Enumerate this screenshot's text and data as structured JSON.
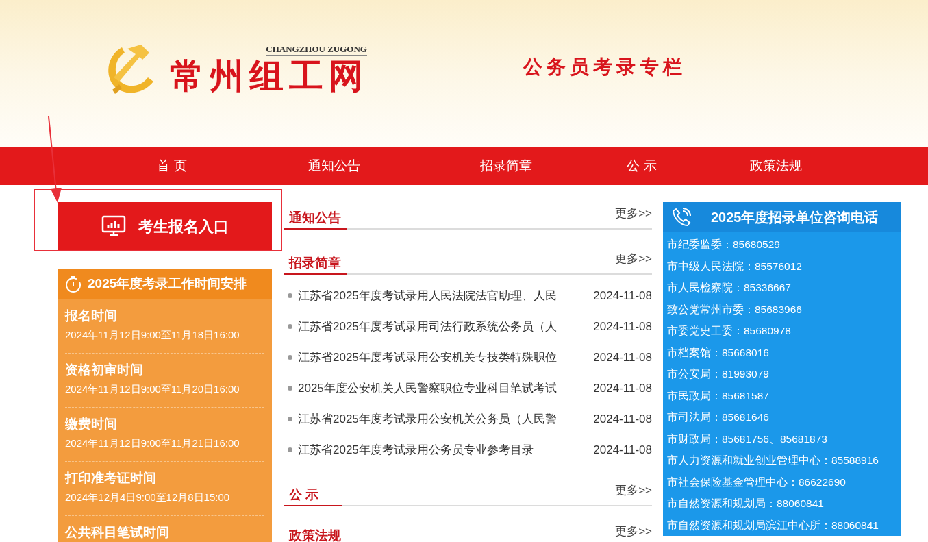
{
  "header": {
    "site_name": "常州组工网",
    "site_name_latin": "CHANGZHOU ZUGONG",
    "column_title": "公务员考录专栏"
  },
  "nav": [
    {
      "label": "首 页"
    },
    {
      "label": "通知公告"
    },
    {
      "label": "招录简章"
    },
    {
      "label": "公 示"
    },
    {
      "label": "政策法规"
    }
  ],
  "register_button": {
    "label": "考生报名入口"
  },
  "annotations": [
    {
      "kind": "arrow"
    },
    {
      "kind": "frame"
    }
  ],
  "schedule": {
    "title": "2025年度考录工作时间安排",
    "items": [
      {
        "label": "报名时间",
        "time": "2024年11月12日9:00至11月18日16:00"
      },
      {
        "label": "资格初审时间",
        "time": "2024年11月12日9:00至11月20日16:00"
      },
      {
        "label": "缴费时间",
        "time": "2024年11月12日9:00至11月21日16:00"
      },
      {
        "label": "打印准考证时间",
        "time": "2024年12月4日9:00至12月8日15:00"
      },
      {
        "label": "公共科目笔试时间"
      }
    ]
  },
  "sections": [
    {
      "title": "通知公告",
      "more": "更多>>"
    },
    {
      "title": "招录简章",
      "more": "更多>>",
      "items": [
        {
          "title": "江苏省2025年度考试录用人民法院法官助理、人民",
          "date": "2024-11-08"
        },
        {
          "title": "江苏省2025年度考试录用司法行政系统公务员（人",
          "date": "2024-11-08"
        },
        {
          "title": "江苏省2025年度考试录用公安机关专技类特殊职位",
          "date": "2024-11-08"
        },
        {
          "title": "2025年度公安机关人民警察职位专业科目笔试考试",
          "date": "2024-11-08"
        },
        {
          "title": "江苏省2025年度考试录用公安机关公务员（人民警",
          "date": "2024-11-08"
        },
        {
          "title": "江苏省2025年度考试录用公务员专业参考目录",
          "date": "2024-11-08"
        }
      ]
    },
    {
      "title": "公 示",
      "more": "更多>>"
    },
    {
      "title": "政策法规",
      "more": "更多>>"
    }
  ],
  "contacts": {
    "title": "2025年度招录单位咨询电话",
    "items": [
      "市纪委监委：85680529",
      "市中级人民法院：85576012",
      "市人民检察院：85336667",
      "致公党常州市委：85683966",
      "市委党史工委：85680978",
      "市档案馆：85668016",
      "市公安局：81993079",
      "市民政局：85681587",
      "市司法局：85681646",
      "市财政局：85681756、85681873",
      "市人力资源和就业创业管理中心：85588916",
      "市社会保险基金管理中心：86622690",
      "市自然资源和规划局：88060841",
      "市自然资源和规划局滨江中心所：88060841"
    ]
  }
}
